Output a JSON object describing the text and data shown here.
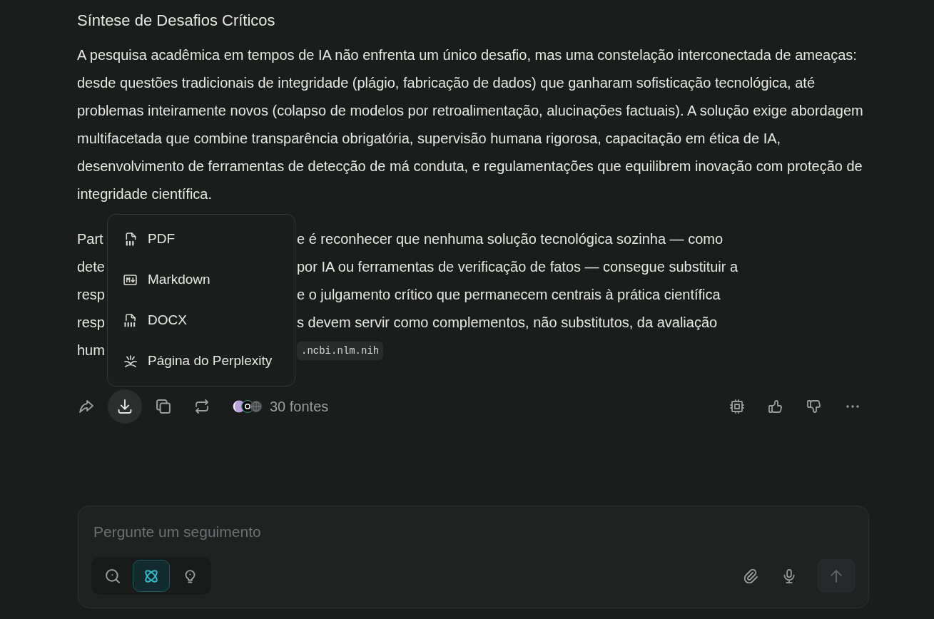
{
  "answer": {
    "heading": "Síntese de Desafios Críticos",
    "paragraph": "A pesquisa acadêmica em tempos de IA não enfrenta um único desafio, mas uma constelação interconectada de ameaças: desde questões tradicionais de integridade (plágio, fabricação de dados) que ganharam sofisticação tecnológica, até problemas inteiramente novos (colapso de modelos por retroalimentação, alucinações factuais). A solução exige abordagem multifacetada que combine transparência obrigatória, supervisão humana rigorosa, capacitação em ética de IA, desenvolvimento de ferramentas de detecção de má conduta, e regulamentações que equilibrem inovação com proteção de integridade científica.",
    "covered_paragraph_lines": [
      {
        "left": "Part",
        "right": "e é reconhecer que nenhuma solução tecnológica sozinha — como"
      },
      {
        "left": "dete",
        "right": "por IA ou ferramentas de verificação de fatos — consegue substituir a"
      },
      {
        "left": "resp",
        "right": "e o julgamento crítico que permanecem centrais à prática científica"
      },
      {
        "left": "resp",
        "right": "s devem servir como complementos, não substitutos, da avaliação"
      },
      {
        "left": "hum",
        "citation": ".ncbi.nlm.nih"
      }
    ]
  },
  "export_menu": {
    "items": [
      {
        "kind": "pdf",
        "label": "PDF"
      },
      {
        "kind": "markdown",
        "label": "Markdown"
      },
      {
        "kind": "docx",
        "label": "DOCX"
      },
      {
        "kind": "page",
        "label": "Página do Perplexity"
      }
    ]
  },
  "action_bar": {
    "buttons": [
      {
        "kind": "share",
        "active": false
      },
      {
        "kind": "download",
        "active": true
      },
      {
        "kind": "copy",
        "active": false
      },
      {
        "kind": "rewrite",
        "active": false
      }
    ],
    "sources": {
      "label": "30 fontes"
    }
  },
  "composer": {
    "placeholder": "Pergunte um seguimento",
    "modes": [
      {
        "kind": "search",
        "selected": false
      },
      {
        "kind": "research",
        "selected": true
      },
      {
        "kind": "labs",
        "selected": false
      }
    ],
    "send": {
      "disabled": true
    }
  }
}
